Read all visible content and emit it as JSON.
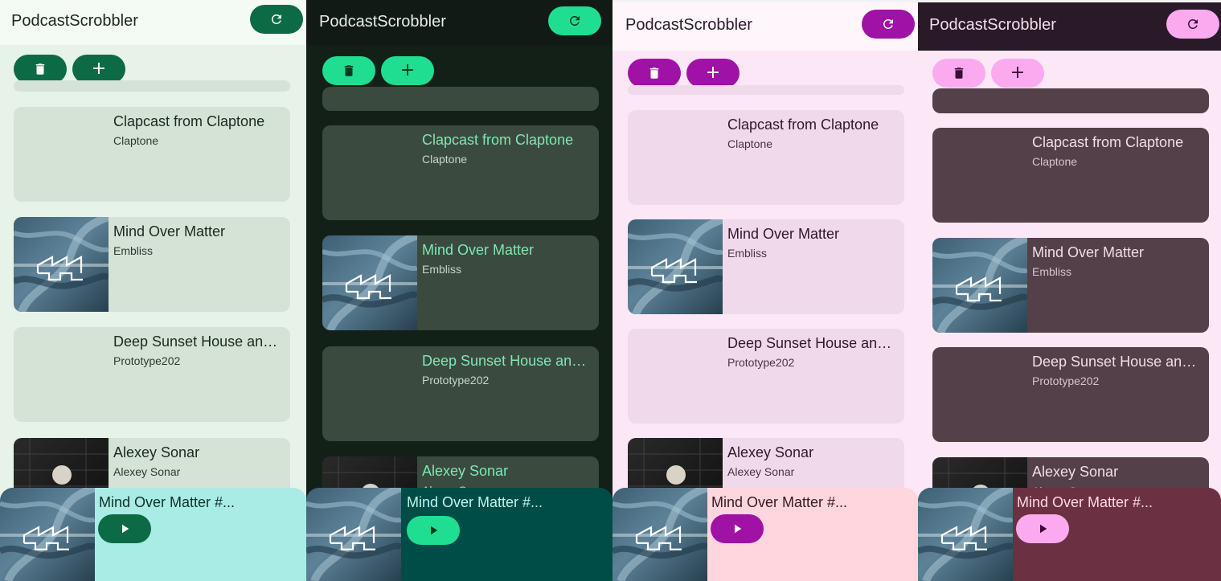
{
  "app": {
    "title": "PodcastScrobbler"
  },
  "episodes": [
    {
      "title": "Clapcast from Claptone",
      "subtitle": "Claptone",
      "artwork": "none"
    },
    {
      "title": "Mind Over Matter",
      "subtitle": "Embliss",
      "artwork": "river-aerial-logo"
    },
    {
      "title": "Deep Sunset House and Melodic Techno",
      "subtitle": "Prototype202",
      "artwork": "none"
    },
    {
      "title": "Alexey Sonar",
      "subtitle": "Alexey Sonar",
      "artwork": "portrait-photo"
    }
  ],
  "player": {
    "title": "Mind Over Matter #...",
    "play_icon": "play-icon"
  },
  "icons": {
    "refresh": "refresh-icon",
    "delete": "trash-icon",
    "add": "plus-icon"
  },
  "themes": [
    {
      "name": "green-light",
      "accent": "#0c6b45",
      "on_accent": "#ffffff",
      "background": "#e7f2e8",
      "card": "#d5e3d7",
      "title_text": "#1a2a1f",
      "player": "#a9ece6"
    },
    {
      "name": "green-dark",
      "accent": "#1fde91",
      "on_accent": "#003a22",
      "background": "#132018",
      "card": "#3b4a3f",
      "title_text": "#7de8b4",
      "player": "#004d48"
    },
    {
      "name": "purple-light",
      "accent": "#a012a6",
      "on_accent": "#ffffff",
      "background": "#fbe7f5",
      "card": "#f0d9ea",
      "title_text": "#2e1a2b",
      "player": "#ffd6dd"
    },
    {
      "name": "purple-dark",
      "accent": "#fbaaf0",
      "on_accent": "#3a0a35",
      "background": "#fbe7f5",
      "card": "#534048",
      "title_text": "#f2dcea",
      "player": "#6b3041"
    }
  ]
}
